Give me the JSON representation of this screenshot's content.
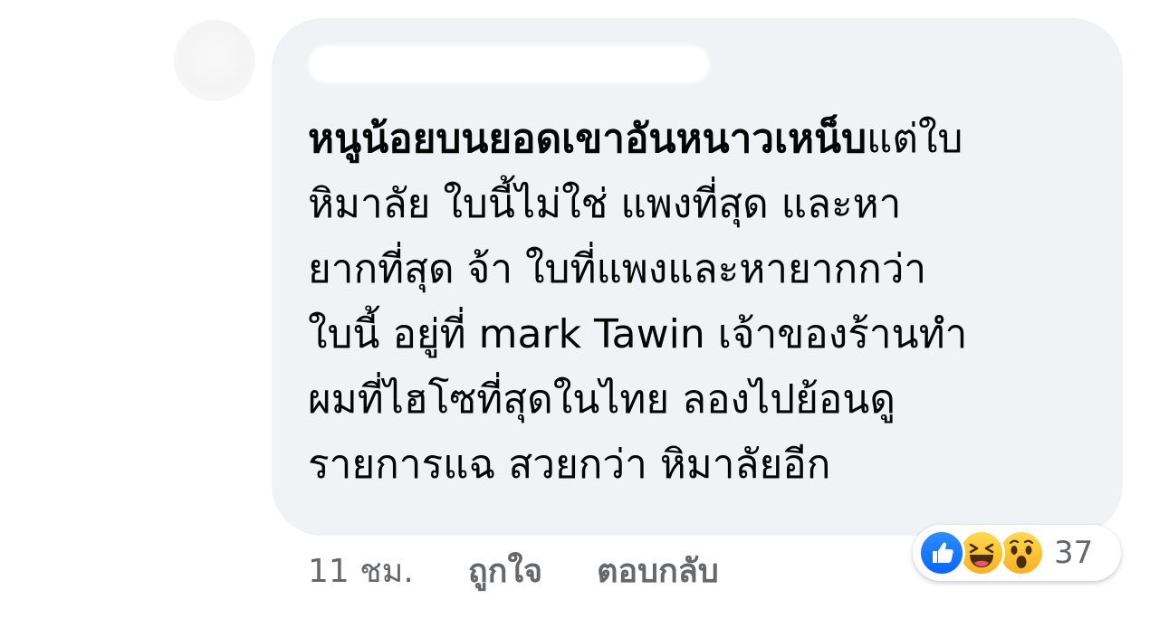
{
  "comment": {
    "text_bold": "หนูน้อยบนยอดเขาอันหนาวเหน็บ",
    "text_rest": "แต่ใบ\nหิมาลัย ใบนี้ไม่ใช่ แพงที่สุด และหา\nยากที่สุด จ้า ใบที่แพงและหายากกว่า\nใบนี้ อยู่ที่ mark Tawin เจ้าของร้านทำ\nผมที่ไฮโซที่สุดในไทย ลองไปย้อนดู\nรายการแฉ สวยกว่า หิมาลัยอีก"
  },
  "reactions": {
    "icons": [
      "like-icon",
      "haha-icon",
      "wow-icon"
    ],
    "count": "37"
  },
  "actions": {
    "time": "11 ชม.",
    "like_label": "ถูกใจ",
    "reply_label": "ตอบกลับ"
  },
  "colors": {
    "bubble": "#f0f2f5",
    "like_blue": "#0866ff",
    "emoji_yellow": "#f7b125",
    "meta_gray": "#65676b"
  }
}
